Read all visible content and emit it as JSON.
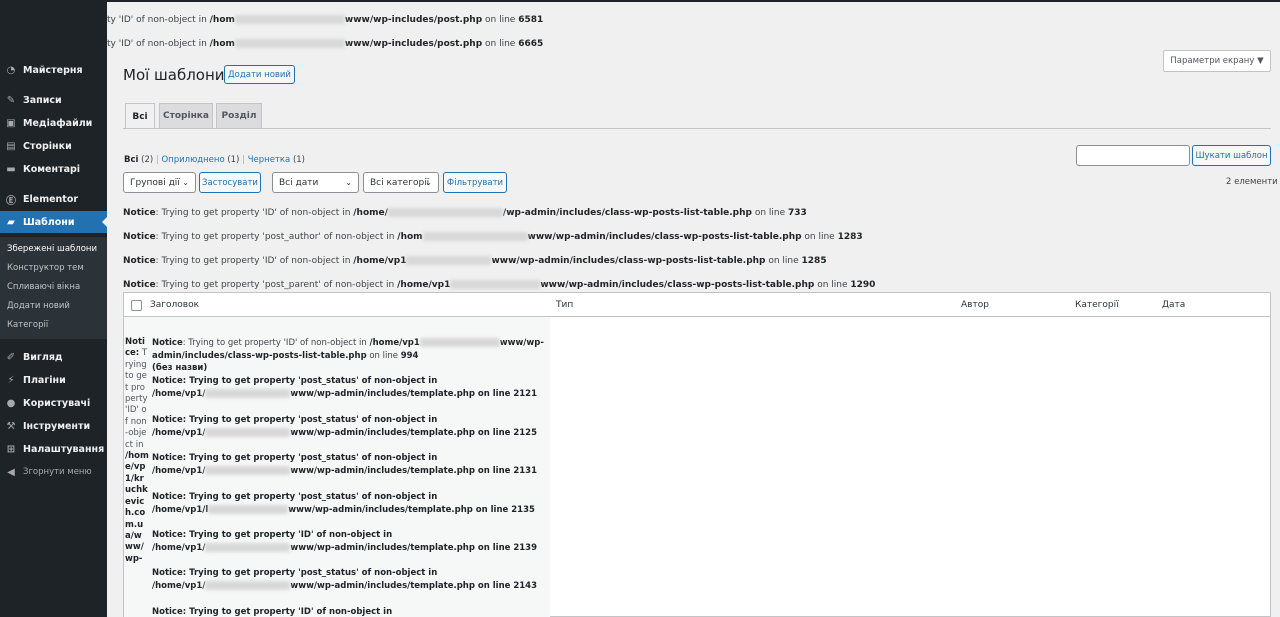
{
  "sidebar": {
    "items": [
      {
        "label": "Майстерня",
        "icon": "dashboard-icon"
      },
      {
        "label": "Записи",
        "icon": "pin-icon"
      },
      {
        "label": "Медіафайли",
        "icon": "media-icon"
      },
      {
        "label": "Сторінки",
        "icon": "page-icon"
      },
      {
        "label": "Коментарі",
        "icon": "comment-icon"
      },
      {
        "label": "Elementor",
        "icon": "elementor-icon"
      },
      {
        "label": "Шаблони",
        "icon": "folder-icon"
      },
      {
        "label": "Вигляд",
        "icon": "brush-icon"
      },
      {
        "label": "Плагіни",
        "icon": "plugin-icon"
      },
      {
        "label": "Користувачі",
        "icon": "user-icon"
      },
      {
        "label": "Інструменти",
        "icon": "wrench-icon"
      },
      {
        "label": "Налаштування",
        "icon": "settings-icon"
      },
      {
        "label": "Згорнути меню",
        "icon": "collapse-icon"
      }
    ],
    "submenu": [
      "Збережені шаблони",
      "Конструктор тем",
      "Спливаючі вікна",
      "Додати новий",
      "Категорії"
    ]
  },
  "top_notices": [
    {
      "pre": "ty 'ID' of non-object in ",
      "path1": "/hom",
      "path2": "www/wp-includes/post.php",
      "suffix": " on line ",
      "line": "6581"
    },
    {
      "pre": "ty 'ID' of non-object in ",
      "path1": "/hom",
      "path2": "www/wp-includes/post.php",
      "suffix": " on line ",
      "line": "6665"
    }
  ],
  "screen_options": "Параметри екрану ▼",
  "page": {
    "title": "Мої шаблони",
    "add_new": "Додати новий"
  },
  "tabs": [
    "Всі",
    "Сторінка",
    "Розділ"
  ],
  "views": {
    "all": "Всі",
    "all_count": "(2)",
    "published": "Оприлюднено",
    "published_count": "(1)",
    "draft": "Чернетка",
    "draft_count": "(1)",
    "sep": "|"
  },
  "search": {
    "value": "",
    "button": "Шукати шаблон"
  },
  "filters": {
    "bulk": "Групові дії",
    "apply": "Застосувати",
    "dates": "Всі дати",
    "categories": "Всі категорії",
    "filter": "Фільтрувати",
    "count": "2 елементи"
  },
  "notices": [
    {
      "label": "Notice",
      "msg": ": Trying to get property 'ID' of non-object in ",
      "p1": "/home/",
      "p2": "/wp-admin/includes/class-wp-posts-list-table.php",
      "tail": " on line ",
      "line": "733"
    },
    {
      "label": "Notice",
      "msg": ": Trying to get property 'post_author' of non-object in ",
      "p1": "/hom",
      "p2": "www/wp-admin/includes/class-wp-posts-list-table.php",
      "tail": " on line ",
      "line": "1283"
    },
    {
      "label": "Notice",
      "msg": ": Trying to get property 'ID' of non-object in ",
      "p1": "/home/vp1",
      "p2": "www/wp-admin/includes/class-wp-posts-list-table.php",
      "tail": " on line ",
      "line": "1285"
    },
    {
      "label": "Notice",
      "msg": ": Trying to get property 'post_parent' of non-object in ",
      "p1": "/home/vp1",
      "p2": "www/wp-admin/includes/class-wp-posts-list-table.php",
      "tail": " on line ",
      "line": "1290"
    }
  ],
  "table": {
    "headers": [
      "Заголовок",
      "Тип",
      "Автор",
      "Категорії",
      "Дата"
    ],
    "narrow_text": "Trying to get property 'ID' of non-object in",
    "narrow_label": "Notice:",
    "narrow_path": "/home/vp1/kruchkevich.com.ua/www/wp-",
    "row_notice1": {
      "label": "Notice",
      "msg": ": Trying to get property 'ID' of non-object in ",
      "p1": "/home/vp1",
      "p2": "www/wp-",
      "p3": "admin/includes/class-wp-posts-list-table.php",
      "tail": " on line ",
      "line": "994"
    },
    "no_title": "(без назви)",
    "bold_notices": [
      {
        "l1": "Notice: Trying to get property 'post_status' of non-object in",
        "p1": "/home/vp1/",
        "p2": "www/wp-admin/includes/template.php on line 2121"
      },
      {
        "l1": "Notice: Trying to get property 'post_status' of non-object in",
        "p1": "/home/vp1/",
        "p2": "www/wp-admin/includes/template.php on line 2125"
      },
      {
        "l1": "Notice: Trying to get property 'post_status' of non-object in",
        "p1": "/home/vp1/",
        "p2": "www/wp-admin/includes/template.php on line 2131"
      },
      {
        "l1": "Notice: Trying to get property 'post_status' of non-object in",
        "p1": "/home/vp1/l",
        "p2": "www/wp-admin/includes/template.php on line 2135"
      },
      {
        "l1": "Notice: Trying to get property 'ID' of non-object in",
        "p1": "/home/vp1/",
        "p2": "www/wp-admin/includes/template.php on line 2139"
      },
      {
        "l1": "Notice: Trying to get property 'post_status' of non-object in",
        "p1": "/home/vp1/",
        "p2": "www/wp-admin/includes/template.php on line 2143"
      },
      {
        "l1": "Notice: Trying to get property 'ID' of non-object in",
        "p1": "",
        "p2": ""
      }
    ]
  }
}
